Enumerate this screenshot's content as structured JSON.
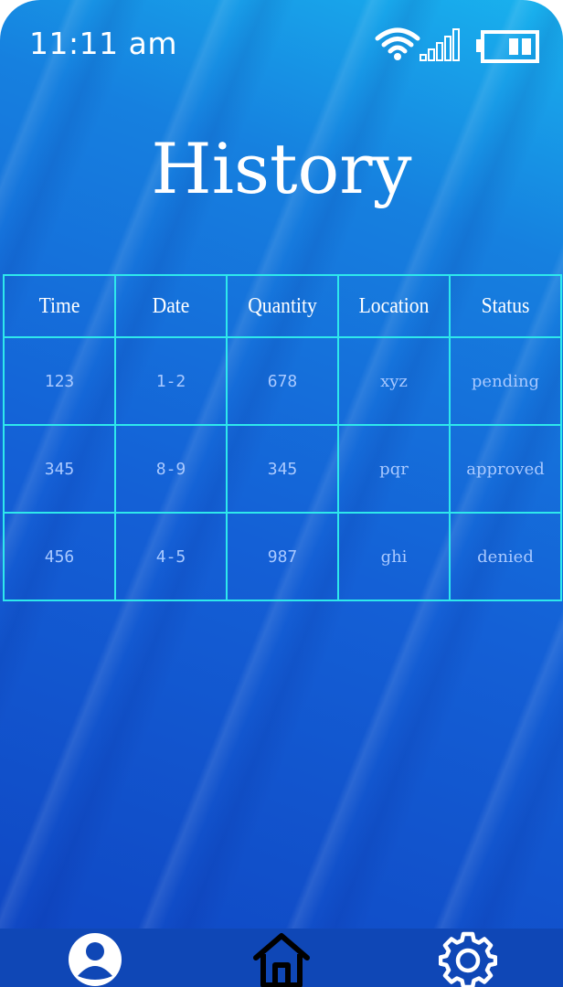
{
  "status_bar": {
    "time": "11:11 am",
    "wifi_icon": "wifi-icon",
    "signal_icon": "signal-bars-icon",
    "battery_icon": "battery-icon"
  },
  "page": {
    "title": "History"
  },
  "table": {
    "headers": [
      "Time",
      "Date",
      "Quantity",
      "Location",
      "Status"
    ],
    "rows": [
      [
        "123",
        "1-2",
        "678",
        "xyz",
        "pending"
      ],
      [
        "345",
        "8-9",
        "345",
        "pqr",
        "approved"
      ],
      [
        "456",
        "4-5",
        "987",
        "ghi",
        "denied"
      ]
    ]
  },
  "bottom_nav": {
    "items": [
      {
        "icon": "profile-icon"
      },
      {
        "icon": "home-icon"
      },
      {
        "icon": "gear-icon"
      }
    ]
  },
  "colors": {
    "background_top": "#19b3ee",
    "background_bottom": "#0f45c2",
    "grid_line": "#2ee8ec",
    "header_text": "#ffffff",
    "cell_text": "#a9c9ff",
    "nav_bar": "#0f47b6"
  }
}
